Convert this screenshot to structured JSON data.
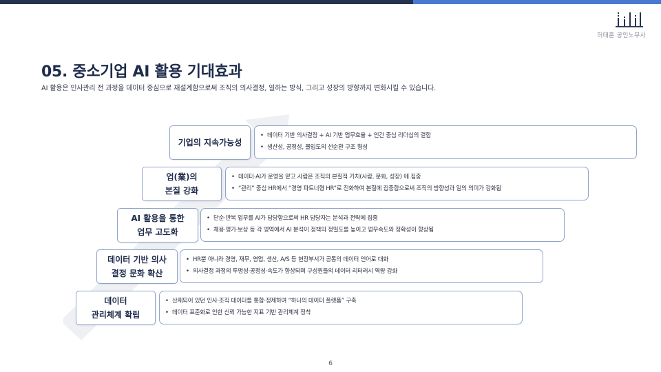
{
  "header": {
    "firm_name": "허태훈 공인노무사"
  },
  "slide": {
    "title": "05. 중소기업 AI 활용 기대효과",
    "subtitle": "AI 활용은 인사관리 전 과정을 데이터 중심으로 재설계함으로써 조직의 의사결정, 일하는 방식, 그리고 성장의 방향까지 변화시킬 수 있습니다."
  },
  "steps": [
    {
      "label_line1": "기업의 지속가능성",
      "label_line2": "",
      "bullets": [
        "데이터 기반 의사결정 + AI 기반 업무효율 + 인간 중심 리더십의 결합",
        "생산성, 공정성, 몰입도의 선순환 구조 형성"
      ]
    },
    {
      "label_line1": "업(業)의",
      "label_line2": "본질 강화",
      "bullets": [
        "데이터·AI가 운영을 맡고 사람은 조직의 본질적 가치(사람, 문화, 성장) 에 집중",
        "“관리” 중심 HR에서 “경영 파트너형 HR”로 진화하여 본질에 집중함으로써 조직의 방향성과 일의 의미가 강화됨"
      ]
    },
    {
      "label_line1": "AI 활용을 통한",
      "label_line2": "업무 고도화",
      "bullets": [
        "단순·반복 업무를 AI가 담당함으로써 HR 담당자는 분석과 전략에 집중",
        "채용·평가·보상 등 각 영역에서 AI 분석이 정책의 정밀도를 높이고 업무속도와 정확성이 향상됨"
      ]
    },
    {
      "label_line1": "데이터 기반 의사",
      "label_line2": "결정 문화 확산",
      "bullets": [
        "HR뿐 아니라 경영, 재무, 영업, 생산, A/S 등 현장부서가 공통의 데이터 언어로 대화",
        "의사결정 과정의 투명성·공정성·속도가 향상되며 구성원들의 데이터 리터러시 역량 강화"
      ]
    },
    {
      "label_line1": "데이터",
      "label_line2": "관리체계 확립",
      "bullets": [
        "산재되어 있던 인사·조직 데이터를 통합·정제하여 “하나의 데이터 플랫폼” 구축",
        "데이터 표준화로 인한 신뢰 가능한 지표 기반 관리체계 정착"
      ]
    }
  ],
  "footer": {
    "page_number": "6"
  },
  "colors": {
    "topbar_dark": "#24324f",
    "topbar_light": "#4a7ad0",
    "title": "#1e2b4a",
    "box_border": "#8fa4c9"
  },
  "icons": {
    "logo": "bar-logo-icon",
    "background_arrow": "up-right-arrow-icon"
  }
}
